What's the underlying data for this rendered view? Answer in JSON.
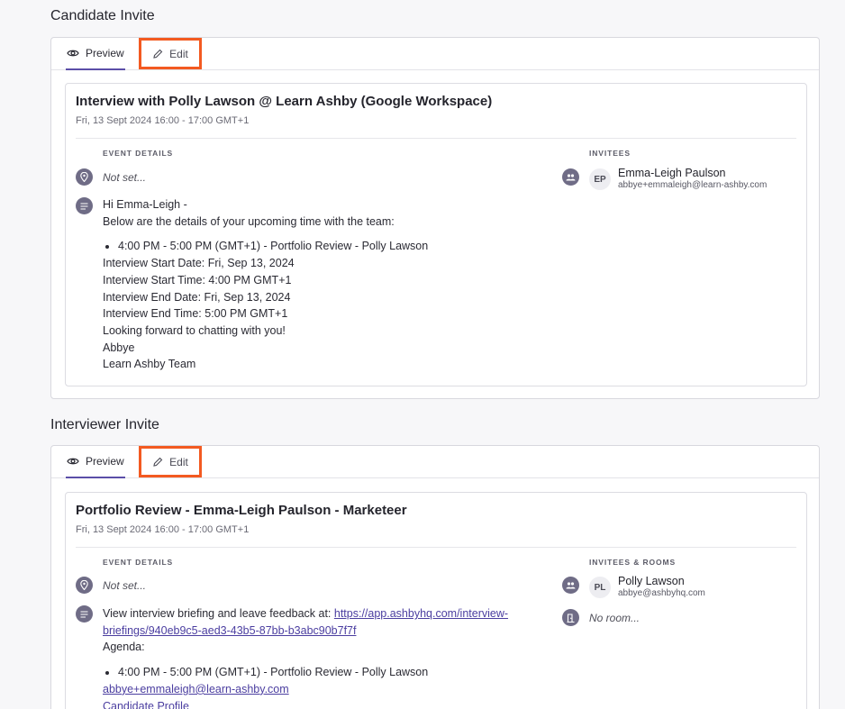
{
  "candidate": {
    "section_title": "Candidate Invite",
    "tab_preview": "Preview",
    "tab_edit": "Edit",
    "title": "Interview with Polly Lawson @ Learn Ashby (Google Workspace)",
    "date": "Fri, 13 Sept 2024 16:00 - 17:00 GMT+1",
    "event_details_label": "EVENT DETAILS",
    "location": "Not set...",
    "invitees_label": "INVITEES",
    "invitee": {
      "initials": "EP",
      "name": "Emma-Leigh Paulson",
      "email": "abbye+emmaleigh@learn-ashby.com"
    },
    "greeting": "Hi Emma-Leigh -",
    "intro": "Below are the details of your upcoming time with the team:",
    "bullet": "4:00 PM - 5:00 PM (GMT+1) - Portfolio Review - Polly Lawson",
    "lines": [
      "Interview Start Date: Fri, Sep 13, 2024",
      "Interview Start Time: 4:00 PM GMT+1",
      "Interview End Date: Fri, Sep 13, 2024",
      "Interview End Time: 5:00 PM GMT+1",
      "Looking forward to chatting with you!",
      "Abbye",
      "Learn Ashby Team"
    ]
  },
  "interviewer": {
    "section_title": "Interviewer Invite",
    "tab_preview": "Preview",
    "tab_edit": "Edit",
    "title": "Portfolio Review - Emma-Leigh Paulson - Marketeer",
    "date": "Fri, 13 Sept 2024 16:00 - 17:00 GMT+1",
    "event_details_label": "EVENT DETAILS",
    "location": "Not set...",
    "invitees_label": "INVITEES & ROOMS",
    "invitee": {
      "initials": "PL",
      "name": "Polly Lawson",
      "email": "abbye@ashbyhq.com"
    },
    "room": "No room...",
    "briefing_prefix": "View interview briefing and leave feedback at: ",
    "briefing_link_1": "https://app.ashbyhq.com/interview-",
    "briefing_link_2": "briefings/940eb9c5-aed3-43b5-87bb-b3abc90b7f7f",
    "agenda": "Agenda:",
    "bullet": "4:00 PM - 5:00 PM (GMT+1) - Portfolio Review - Polly Lawson",
    "candidate_email": "abbye+emmaleigh@learn-ashby.com",
    "candidate_profile": "Candidate Profile"
  },
  "colors": {
    "accent": "#5b4ea8",
    "highlight": "#f35a21",
    "icon_bg": "#6f6c86",
    "link": "#4b3ea0"
  }
}
